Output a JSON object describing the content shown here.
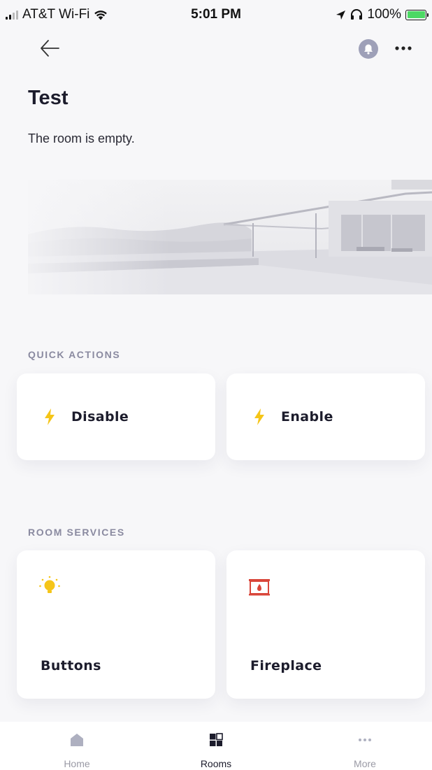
{
  "status_bar": {
    "carrier": "AT&T Wi-Fi",
    "time": "5:01 PM",
    "battery": "100%",
    "icons": [
      "signal-icon",
      "wifi-icon",
      "location-icon",
      "headphones-icon",
      "battery-charging-icon"
    ]
  },
  "header": {
    "back_icon": "arrow-left-icon",
    "notification_icon": "bell-icon",
    "more_icon": "ellipsis-icon"
  },
  "room": {
    "title": "Test",
    "status": "The room is empty."
  },
  "quick_actions": {
    "heading": "QUICK ACTIONS",
    "items": [
      {
        "label": "Disable",
        "icon": "lightning-bolt-icon"
      },
      {
        "label": "Enable",
        "icon": "lightning-bolt-icon"
      }
    ]
  },
  "room_services": {
    "heading": "ROOM SERVICES",
    "items": [
      {
        "label": "Buttons",
        "icon": "lightbulb-icon"
      },
      {
        "label": "Fireplace",
        "icon": "fireplace-icon"
      }
    ]
  },
  "tab_bar": {
    "tabs": [
      {
        "label": "Home",
        "icon": "house-icon",
        "active": false
      },
      {
        "label": "Rooms",
        "icon": "grid-icon",
        "active": true
      },
      {
        "label": "More",
        "icon": "ellipsis-icon",
        "active": false
      }
    ]
  },
  "colors": {
    "background": "#f7f7f9",
    "card": "#ffffff",
    "bolt": "#f5c518",
    "bulb": "#f5c518",
    "fireplace": "#d9463a",
    "section_label": "#8a8aa0",
    "tab_inactive": "#9a9aa5",
    "tab_inactive_icon": "#aeb0c0"
  }
}
